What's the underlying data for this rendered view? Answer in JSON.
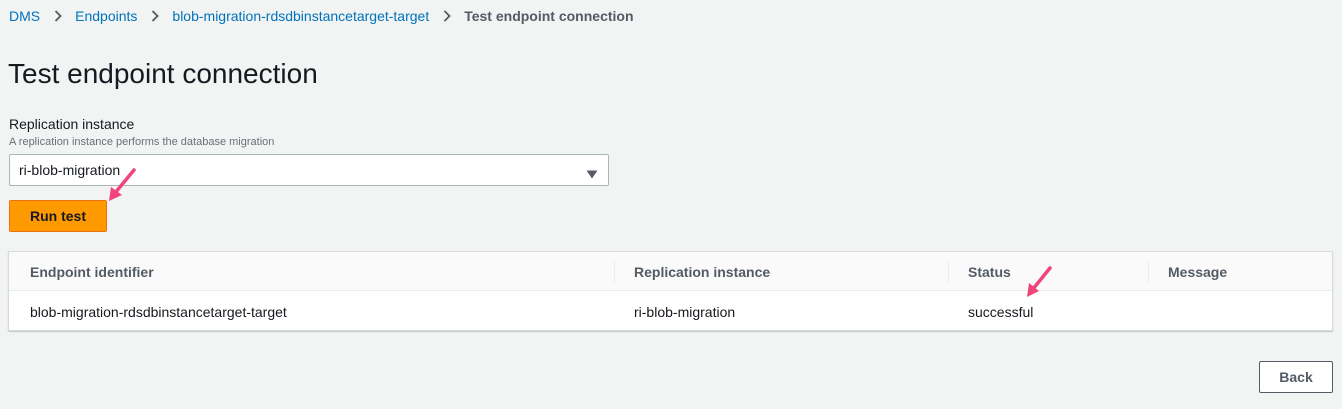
{
  "breadcrumb": {
    "items": [
      {
        "label": "DMS",
        "link": true
      },
      {
        "label": "Endpoints",
        "link": true
      },
      {
        "label": "blob-migration-rdsdbinstancetarget-target",
        "link": true
      },
      {
        "label": "Test endpoint connection",
        "link": false
      }
    ],
    "separator_icon": "chevron-right-icon"
  },
  "page": {
    "title": "Test endpoint connection"
  },
  "replication_field": {
    "label": "Replication instance",
    "description": "A replication instance performs the database migration",
    "selected_value": "ri-blob-migration",
    "caret_icon": "caret-down-icon"
  },
  "actions": {
    "run_test_label": "Run test",
    "back_label": "Back"
  },
  "table": {
    "columns": [
      "Endpoint identifier",
      "Replication instance",
      "Status",
      "Message"
    ],
    "rows": [
      {
        "endpoint_identifier": "blob-migration-rdsdbinstancetarget-target",
        "replication_instance": "ri-blob-migration",
        "status": "successful",
        "message": ""
      }
    ]
  },
  "colors": {
    "accent_orange": "#ff9900",
    "link_blue": "#0073bb",
    "annotation_pink": "#f0447a",
    "background": "#f2f3f3"
  },
  "annotations": {
    "arrow_icon": "annotation-arrow-icon"
  }
}
